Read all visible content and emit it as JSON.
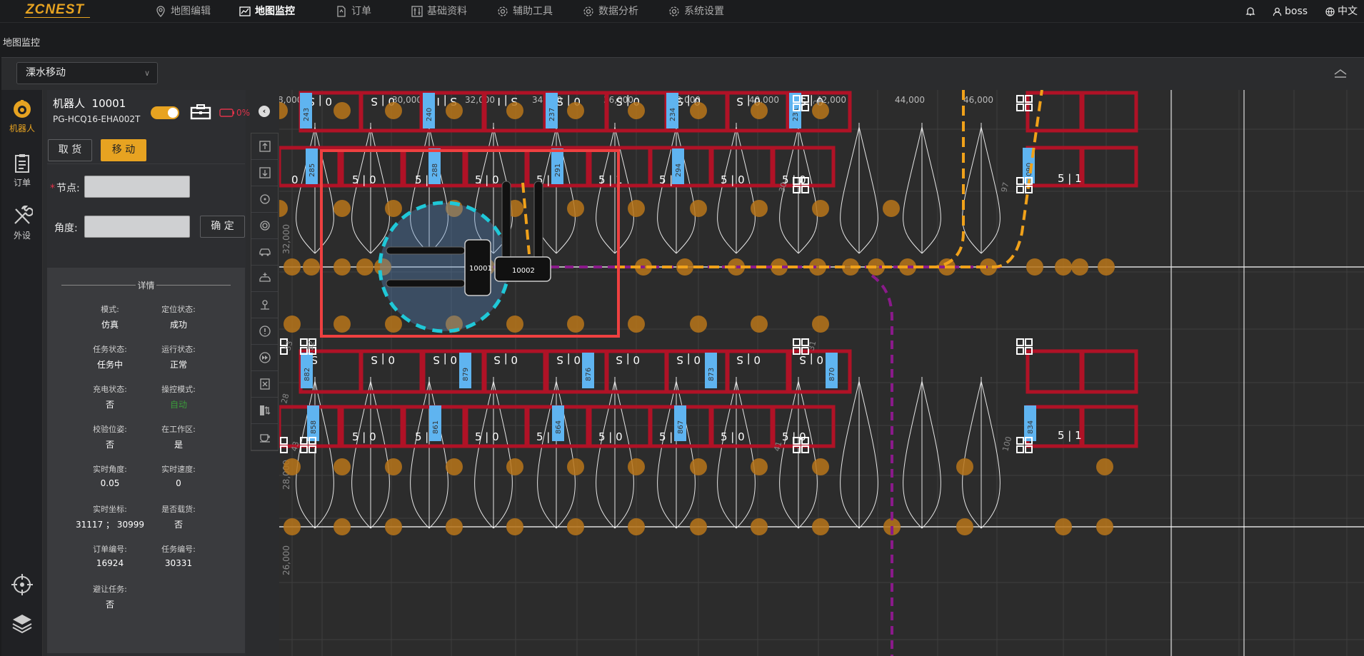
{
  "app": {
    "logo": "ZCNEST"
  },
  "nav": {
    "items": [
      {
        "label": "地图编辑",
        "icon": "map-pin-icon"
      },
      {
        "label": "地图监控",
        "icon": "chart-line-icon",
        "active": true
      },
      {
        "label": "订单",
        "icon": "document-icon"
      },
      {
        "label": "基础资料",
        "icon": "sliders-icon"
      },
      {
        "label": "辅助工具",
        "icon": "gear-icon"
      },
      {
        "label": "数据分析",
        "icon": "gear-icon"
      },
      {
        "label": "系统设置",
        "icon": "gear-icon"
      }
    ],
    "user": "boss",
    "language": "中文"
  },
  "breadcrumb": "地图监控",
  "filter": {
    "selected": "溧水移动"
  },
  "rail": {
    "items": [
      {
        "label": "机器人",
        "icon": "robot-icon",
        "active": true
      },
      {
        "label": "订单",
        "icon": "clipboard-icon"
      },
      {
        "label": "外设",
        "icon": "tools-icon"
      }
    ]
  },
  "robot": {
    "title": "机器人  10001",
    "model": "PG-HCQ16-EHA002T",
    "battery": "0%",
    "buttons": {
      "pick": "取 货",
      "move": "移 动",
      "confirm": "确 定"
    },
    "form": {
      "node_label": "节点:",
      "angle_label": "角度:",
      "node_value": "",
      "angle_value": ""
    },
    "details_title": "详情",
    "details": [
      {
        "label": "模式:",
        "value": "仿真"
      },
      {
        "label": "定位状态:",
        "value": "成功"
      },
      {
        "label": "任务状态:",
        "value": "任务中"
      },
      {
        "label": "运行状态:",
        "value": "正常"
      },
      {
        "label": "充电状态:",
        "value": "否"
      },
      {
        "label": "操控模式:",
        "value": "自动",
        "green": true
      },
      {
        "label": "校验位姿:",
        "value": "否"
      },
      {
        "label": "在工作区:",
        "value": "是"
      },
      {
        "label": "实时角度:",
        "value": "0.05"
      },
      {
        "label": "实时速度:",
        "value": "0"
      },
      {
        "label": "实时坐标:",
        "value": "31117 ； 30999"
      },
      {
        "label": "是否载货:",
        "value": "否"
      },
      {
        "label": "订单编号:",
        "value": "16924"
      },
      {
        "label": "任务编号:",
        "value": "30331"
      },
      {
        "label": "避让任务:",
        "value": "否"
      }
    ]
  },
  "map": {
    "x_ticks": [
      "30,000",
      "32,000",
      "34,000",
      "36,000",
      "38,000",
      "40,000",
      "42,000",
      "44,000",
      "46,000"
    ],
    "x_tick_partial_left": "8,000",
    "y_ticks": [
      "32,000",
      "28,000",
      "26,000"
    ],
    "robots": [
      "10001",
      "10002"
    ],
    "top_row_ids": [
      "243",
      "240",
      "237",
      "234",
      "231"
    ],
    "row2_ids": [
      "285",
      "288",
      "291",
      "294",
      "090"
    ],
    "row3_ids": [
      "882",
      "879",
      "876",
      "873",
      "870"
    ],
    "row4_ids": [
      "858",
      "861",
      "864",
      "867",
      "834"
    ],
    "slot_text_a": "5 | 0",
    "slot_text_b": "5 | 1",
    "node_labels": [
      "30",
      "33",
      "32",
      "31",
      "44",
      "43",
      "41",
      "97",
      "100",
      "28",
      "2"
    ]
  },
  "colors": {
    "accent": "#e7a321",
    "rack": "#b01226",
    "id_tag": "#5fb4f0",
    "route_orange": "#f0a11a",
    "route_purple": "#8a1a8a",
    "selection": "#ee4040",
    "target": "#1fc8d8"
  }
}
